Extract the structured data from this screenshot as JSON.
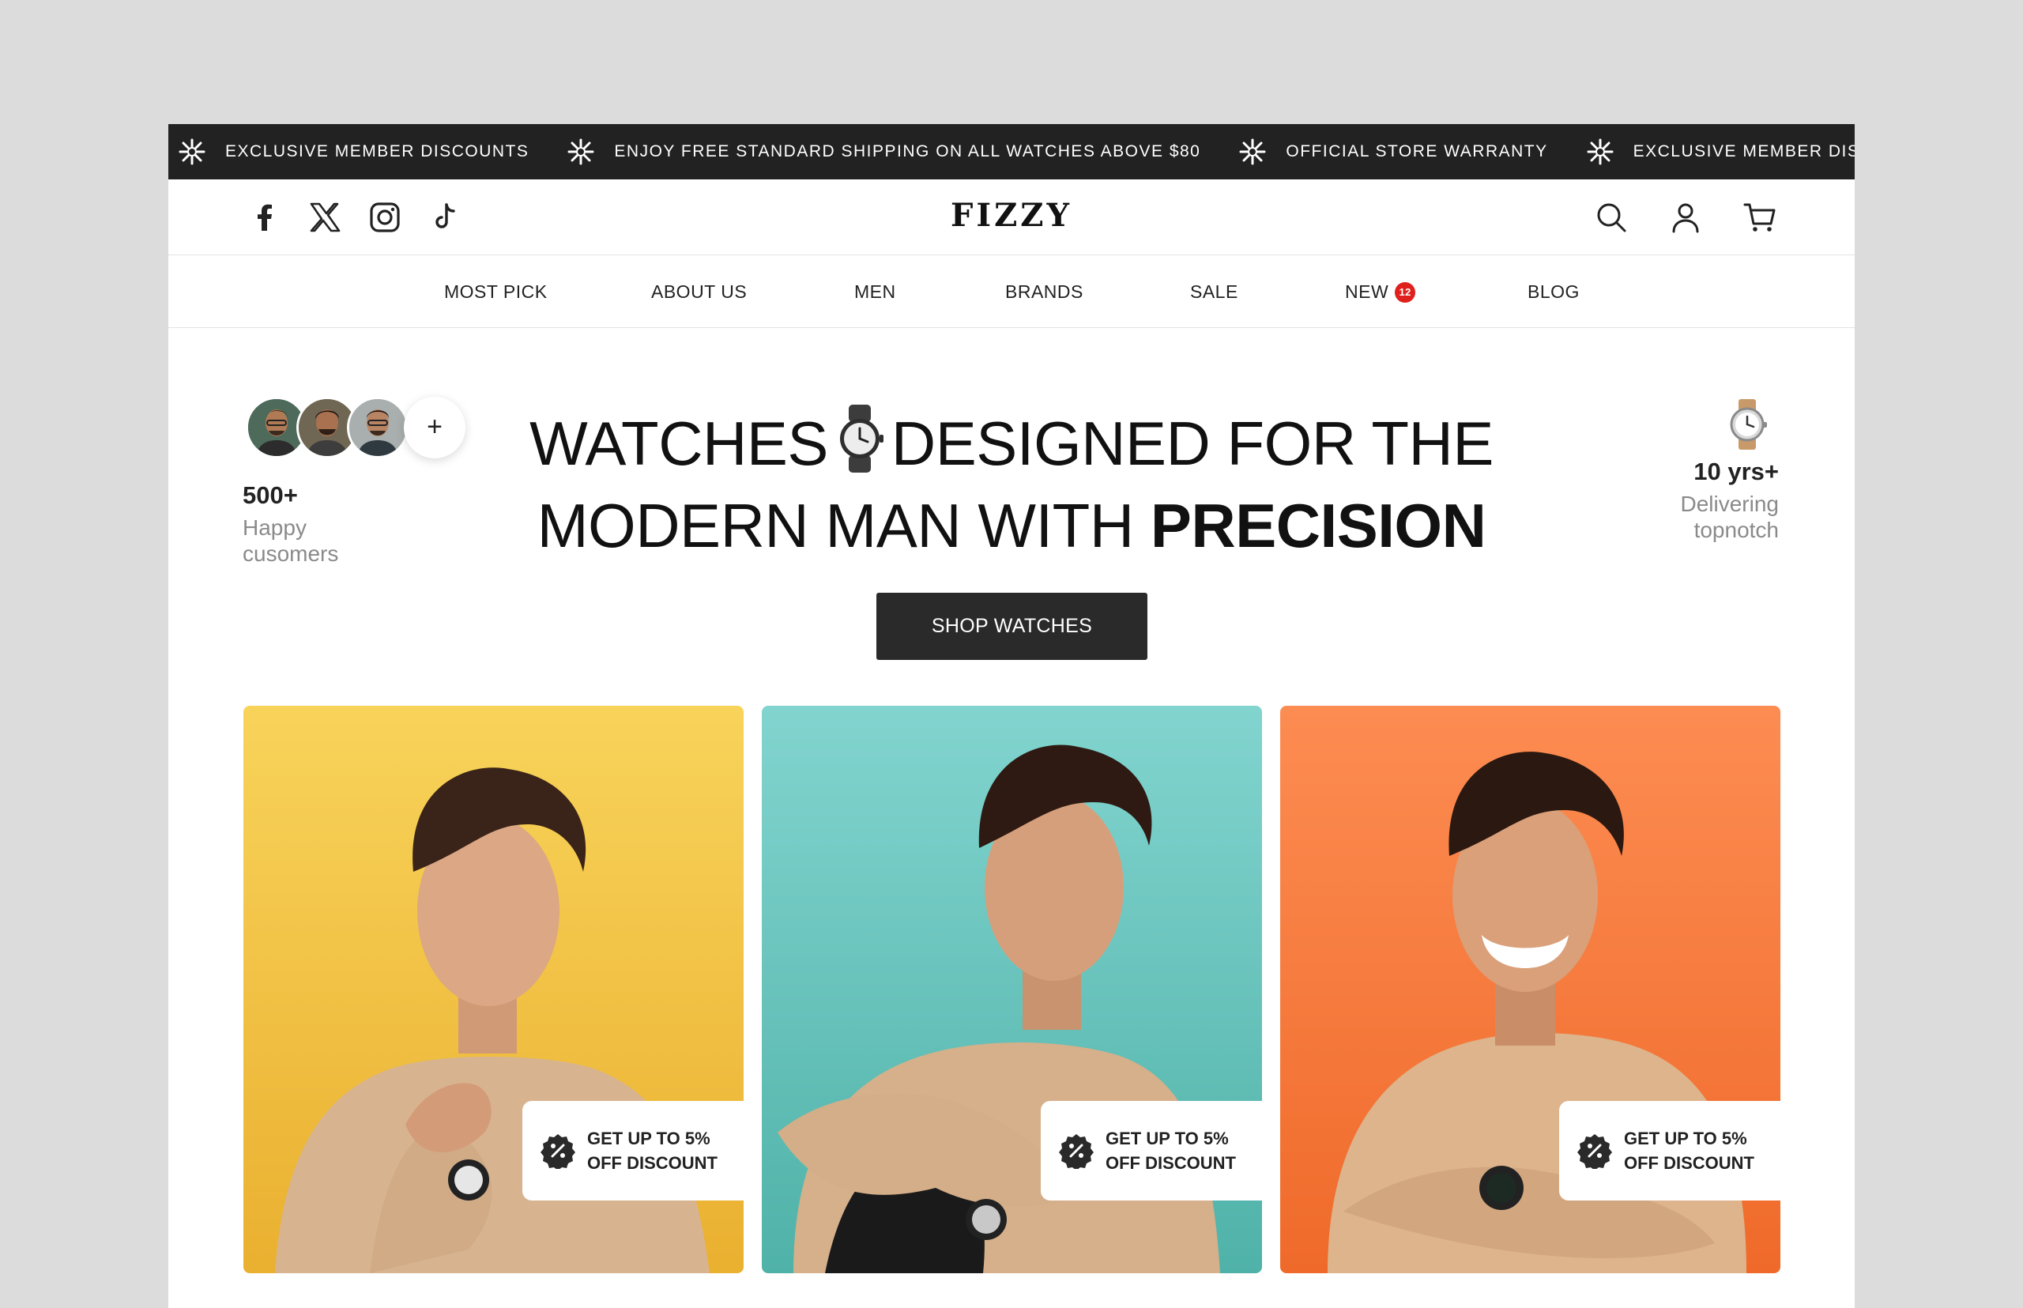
{
  "announcement": {
    "items": [
      "EXCLUSIVE MEMBER DISCOUNTS",
      "ENJOY FREE STANDARD SHIPPING ON ALL WATCHES ABOVE $80",
      "OFFICIAL STORE WARRANTY",
      "EXCLUSIVE MEMBER DISCOUNTS"
    ]
  },
  "header": {
    "brand": "FIZZY",
    "socials": [
      "facebook-icon",
      "x-icon",
      "instagram-icon",
      "tiktok-icon"
    ],
    "actions": [
      "search-icon",
      "user-icon",
      "cart-icon"
    ]
  },
  "nav": {
    "items": [
      {
        "label": "MOST PICK"
      },
      {
        "label": "ABOUT US"
      },
      {
        "label": "MEN"
      },
      {
        "label": "BRANDS"
      },
      {
        "label": "SALE"
      },
      {
        "label": "NEW",
        "badge": "12"
      },
      {
        "label": "BLOG"
      }
    ]
  },
  "hero": {
    "headline_part1": "WATCHES",
    "headline_part2": "DESIGNED FOR THE",
    "headline_part3": "MODERN MAN WITH",
    "headline_bold": "PRECISION",
    "cta": "SHOP WATCHES",
    "customers": {
      "count": "500+",
      "label": "Happy cusomers",
      "plus": "+"
    },
    "experience": {
      "count": "10 yrs+",
      "label": "Delivering topnotch"
    }
  },
  "cards": [
    {
      "bg": "#f6c84a",
      "promo": "GET UP TO 5% OFF DISCOUNT"
    },
    {
      "bg": "#6fcfc8",
      "promo": "GET UP TO 5% OFF DISCOUNT"
    },
    {
      "bg": "#f9874a",
      "promo": "GET UP TO 5% OFF DISCOUNT"
    }
  ],
  "colors": {
    "announcement_bg": "#222222",
    "cta_bg": "#2a2a2a",
    "badge": "#e0201c"
  }
}
